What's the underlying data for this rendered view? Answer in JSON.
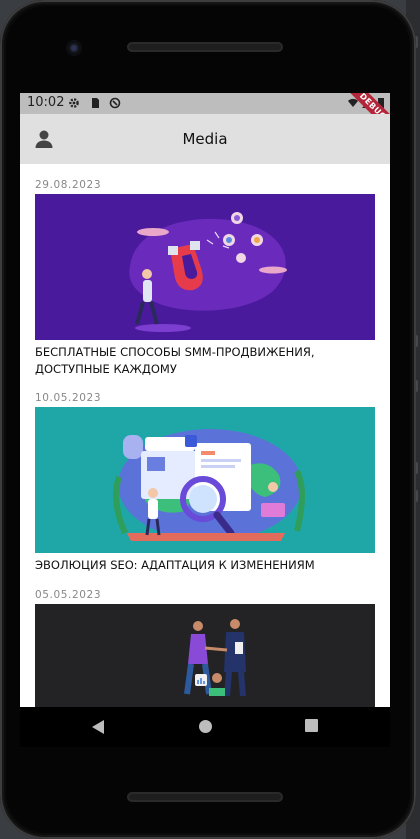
{
  "status": {
    "time": "10:02",
    "debug_label": "DEBUG",
    "icons": [
      "settings-icon",
      "sd-card-icon",
      "sync-icon",
      "wifi-icon",
      "signal-icon",
      "battery-icon"
    ]
  },
  "appbar": {
    "title": "Media",
    "profile_icon": "person-icon"
  },
  "articles": [
    {
      "date": "29.08.2023",
      "title": "БЕСПЛАТНЫЕ СПОСОБЫ SMM-ПРОДВИЖЕНИЯ, ДОСТУПНЫЕ КАЖДОМУ",
      "image_bg": "#4a1a9c"
    },
    {
      "date": "10.05.2023",
      "title": "ЭВОЛЮЦИЯ SEO: АДАПТАЦИЯ К ИЗМЕНЕНИЯМ",
      "image_bg": "#1fa7a7"
    },
    {
      "date": "05.05.2023",
      "title": "",
      "image_bg": "#232326"
    }
  ],
  "navbar": {
    "buttons": [
      "back-icon",
      "home-icon",
      "recents-icon"
    ]
  }
}
